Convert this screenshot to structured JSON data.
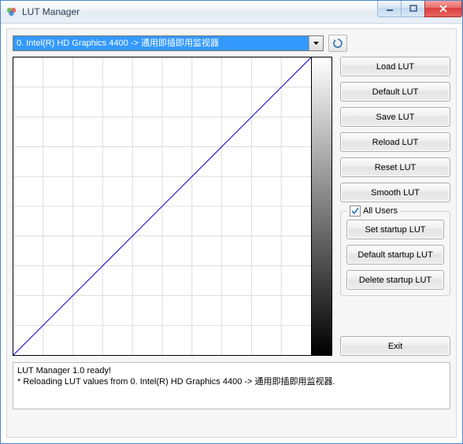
{
  "window": {
    "title": "LUT Manager"
  },
  "device": {
    "selected": "0. Intel(R) HD Graphics 4400 -> 通用即插即用监视器"
  },
  "buttons": {
    "load": "Load LUT",
    "default": "Default LUT",
    "save": "Save LUT",
    "reload": "Reload LUT",
    "reset": "Reset LUT",
    "smooth": "Smooth LUT",
    "set_startup": "Set startup LUT",
    "default_startup": "Default startup LUT",
    "delete_startup": "Delete startup LUT",
    "exit": "Exit"
  },
  "group": {
    "all_users_label": "All Users",
    "all_users_checked": true
  },
  "log": {
    "line1": "LUT Manager 1.0 ready!",
    "line2": "* Reloading LUT values from 0. Intel(R) HD Graphics 4400 -> 通用即插即用监视器."
  },
  "chart_data": {
    "type": "line",
    "x": [
      0,
      255
    ],
    "y": [
      0,
      255
    ],
    "xlim": [
      0,
      255
    ],
    "ylim": [
      0,
      255
    ],
    "grid": true,
    "grid_divisions": 10,
    "title": "",
    "xlabel": "",
    "ylabel": ""
  }
}
